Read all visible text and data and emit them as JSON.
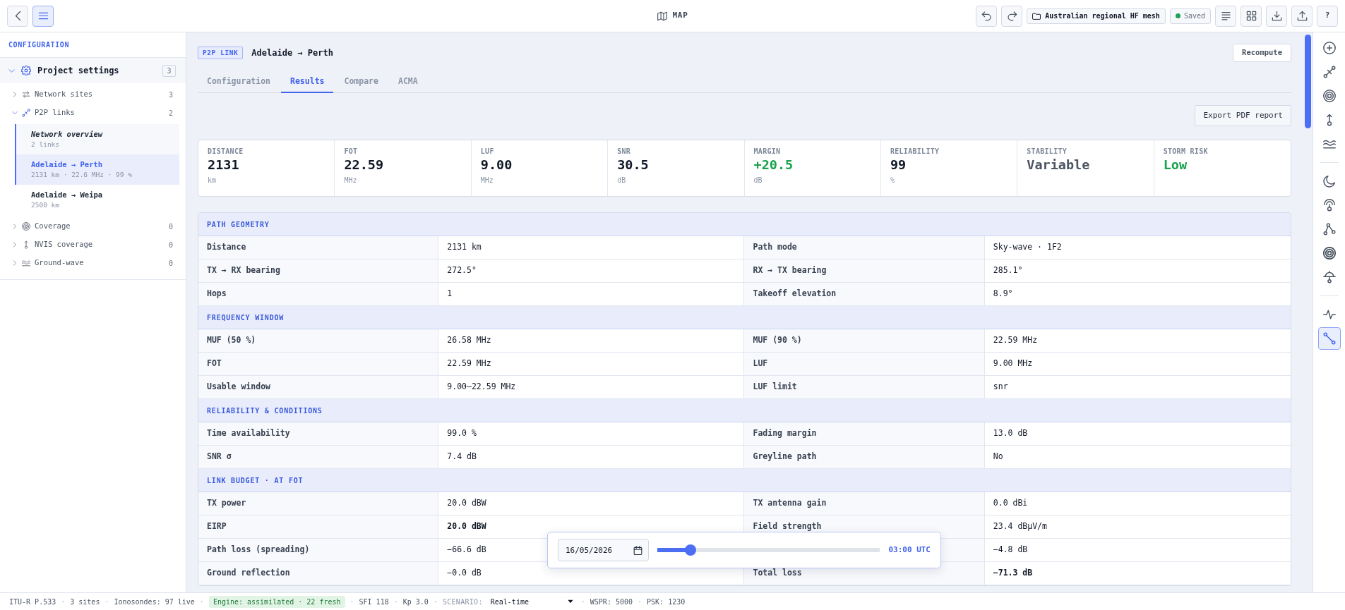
{
  "top_bar": {
    "nav_buttons": [
      {
        "kind": "back",
        "on": false
      },
      {
        "kind": "menu",
        "on": true
      }
    ],
    "title": "MAP",
    "history_buttons": [
      {
        "kind": "undo"
      },
      {
        "kind": "redo"
      }
    ],
    "project": "Australian regional HF mesh",
    "save_status": "Saved",
    "tool_buttons": [
      {
        "kind": "outline"
      },
      {
        "kind": "grid"
      },
      {
        "kind": "download"
      },
      {
        "kind": "upload"
      },
      {
        "kind": "help",
        "label": "?"
      }
    ]
  },
  "sidebar": {
    "title": "CONFIGURATION",
    "tree": [
      {
        "kind": "settings",
        "label": "Project settings",
        "count": "3",
        "expanded": true,
        "children": [
          {
            "kind": "sites",
            "label": "Network sites",
            "count": "3",
            "expanded": false
          },
          {
            "kind": "links",
            "label": "P2P links",
            "count": "2",
            "expanded": true,
            "children": [
              {
                "kind": "overview",
                "title": "Network overview",
                "detail": "2 links",
                "selected": false
              },
              {
                "kind": "link",
                "title": "Adelaide → Perth",
                "detail": "2131 km · 22.6 MHz · 99 %",
                "selected": true
              },
              {
                "kind": "link",
                "title": "Adelaide → Weipa",
                "detail": "2500 km",
                "selected": false
              }
            ]
          },
          {
            "kind": "coverage",
            "label": "Coverage",
            "count": "0",
            "expanded": false
          },
          {
            "kind": "nvis",
            "label": "NVIS coverage",
            "count": "0",
            "expanded": false
          },
          {
            "kind": "groundwave",
            "label": "Ground-wave",
            "count": "0",
            "expanded": false
          }
        ]
      }
    ]
  },
  "link": {
    "type": "P2P LINK",
    "title": "Adelaide → Perth",
    "action": "Recompute"
  },
  "tabs": [
    {
      "label": "Configuration",
      "selected": false
    },
    {
      "label": "Results",
      "selected": true
    },
    {
      "label": "Compare",
      "selected": false
    },
    {
      "label": "ACMA",
      "selected": false
    }
  ],
  "export_button": "Export PDF report",
  "metrics": [
    {
      "label": "DISTANCE",
      "value": "2131",
      "unit": "km",
      "color": "#111827"
    },
    {
      "label": "FOT",
      "value": "22.59",
      "unit": "MHz",
      "color": "#111827"
    },
    {
      "label": "LUF",
      "value": "9.00",
      "unit": "MHz",
      "color": "#111827"
    },
    {
      "label": "SNR",
      "value": "30.5",
      "unit": "dB",
      "color": "#111827"
    },
    {
      "label": "MARGIN",
      "value": "+20.5",
      "unit": "dB",
      "color": "#16a34a"
    },
    {
      "label": "RELIABILITY",
      "value": "99",
      "unit": "%",
      "color": "#111827"
    },
    {
      "label": "STABILITY",
      "value": "Variable",
      "color": "#4b5563"
    },
    {
      "label": "STORM RISK",
      "value": "Low",
      "color": "#16a34a"
    }
  ],
  "sections": [
    {
      "title": "PATH GEOMETRY",
      "rows": [
        [
          {
            "label": "Distance",
            "value": "2131 km",
            "strong": false
          },
          {
            "label": "Path mode",
            "value": "Sky-wave · 1F2",
            "strong": false
          }
        ],
        [
          {
            "label": "TX → RX bearing",
            "value": "272.5°",
            "strong": false
          },
          {
            "label": "RX → TX bearing",
            "value": "285.1°",
            "strong": false
          }
        ],
        [
          {
            "label": "Hops",
            "value": "1",
            "strong": false
          },
          {
            "label": "Takeoff elevation",
            "value": "8.9°",
            "strong": false
          }
        ]
      ]
    },
    {
      "title": "FREQUENCY WINDOW",
      "rows": [
        [
          {
            "label": "MUF (50 %)",
            "value": "26.58 MHz",
            "strong": false
          },
          {
            "label": "MUF (90 %)",
            "value": "22.59 MHz",
            "strong": false
          }
        ],
        [
          {
            "label": "FOT",
            "value": "22.59 MHz",
            "strong": false
          },
          {
            "label": "LUF",
            "value": "9.00 MHz",
            "strong": false
          }
        ],
        [
          {
            "label": "Usable window",
            "value": "9.00–22.59 MHz",
            "strong": false
          },
          {
            "label": "LUF limit",
            "value": "snr",
            "strong": false
          }
        ]
      ]
    },
    {
      "title": "RELIABILITY & CONDITIONS",
      "rows": [
        [
          {
            "label": "Time availability",
            "value": "99.0 %",
            "strong": false
          },
          {
            "label": "Fading margin",
            "value": "13.0 dB",
            "strong": false
          }
        ],
        [
          {
            "label": "SNR σ",
            "value": "7.4 dB",
            "strong": false
          },
          {
            "label": "Greyline path",
            "value": "No",
            "strong": false
          }
        ]
      ]
    },
    {
      "title": "LINK BUDGET · AT FOT",
      "rows": [
        [
          {
            "label": "TX power",
            "value": "20.0 dBW",
            "strong": false
          },
          {
            "label": "TX antenna gain",
            "value": "0.0 dBi",
            "strong": false
          }
        ],
        [
          {
            "label": "EIRP",
            "value": "20.0 dBW",
            "strong": true
          },
          {
            "label": "Field strength",
            "value": "23.4 dBµV/m",
            "strong": false
          }
        ],
        [
          {
            "label": "Path loss (spreading)",
            "value": "−66.6 dB",
            "strong": false
          },
          {
            "value": "−4.8 dB",
            "strong": false
          }
        ],
        [
          {
            "label": "Ground reflection",
            "value": "−0.0 dB",
            "strong": false
          },
          {
            "label": "Total loss",
            "value": "−71.3 dB",
            "strong": true
          }
        ]
      ]
    }
  ],
  "time_popup": {
    "date": "16/05/2026",
    "level": 0.13,
    "time": "03:00 UTC"
  },
  "tool_rail": {
    "groups": [
      [
        {
          "kind": "add",
          "selected": false
        },
        {
          "kind": "link",
          "selected": false
        },
        {
          "kind": "coverage",
          "selected": false
        },
        {
          "kind": "nvis",
          "selected": false
        },
        {
          "kind": "groundwave",
          "selected": false
        }
      ],
      [
        {
          "kind": "night",
          "selected": false
        },
        {
          "kind": "ionosonde",
          "selected": false
        },
        {
          "kind": "network",
          "selected": false
        },
        {
          "kind": "target",
          "selected": false
        },
        {
          "kind": "antenna",
          "selected": false
        }
      ],
      [
        {
          "kind": "activity",
          "selected": false
        },
        {
          "kind": "segment",
          "selected": true
        }
      ]
    ]
  },
  "status_bar": {
    "items": [
      {
        "kind": "text",
        "text": "ITU-R P.533"
      },
      {
        "kind": "sep",
        "text": "·"
      },
      {
        "kind": "text",
        "text": "3 sites"
      },
      {
        "kind": "sep",
        "text": "·"
      },
      {
        "kind": "text",
        "text": "Ionosondes: 97 live"
      },
      {
        "kind": "sep",
        "text": "·"
      },
      {
        "kind": "badge",
        "text": "Engine: assimilated · 22 fresh"
      },
      {
        "kind": "sep",
        "text": "·"
      },
      {
        "kind": "text",
        "text": "SFI 118"
      },
      {
        "kind": "sep",
        "text": "·"
      },
      {
        "kind": "text",
        "text": "Kp 3.0"
      },
      {
        "kind": "sep",
        "text": "·"
      },
      {
        "kind": "label",
        "text": "SCENARIO:"
      },
      {
        "kind": "select",
        "text": "Real-time"
      },
      {
        "kind": "sep",
        "text": "·"
      },
      {
        "kind": "text",
        "text": "WSPR: 5000"
      },
      {
        "kind": "sep",
        "text": "·"
      },
      {
        "kind": "text",
        "text": "PSK: 1230"
      }
    ]
  }
}
